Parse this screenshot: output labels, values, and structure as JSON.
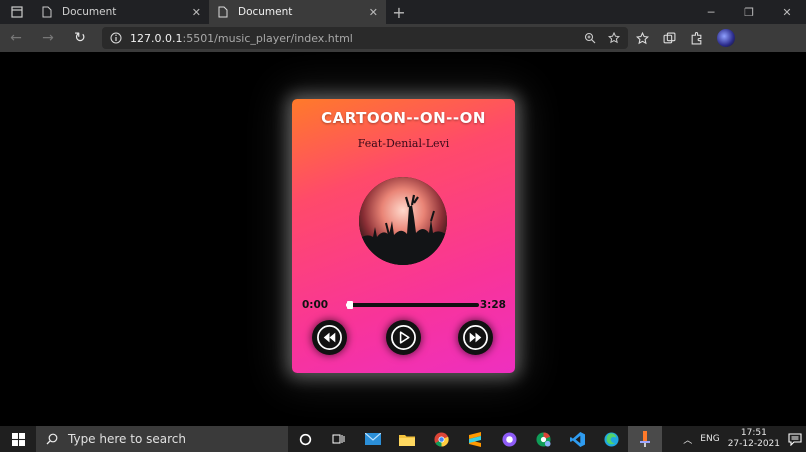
{
  "browser": {
    "tabs": [
      {
        "title": "Document",
        "active": false
      },
      {
        "title": "Document",
        "active": true
      }
    ],
    "url_host": "127.0.0.1",
    "url_rest": ":5501/music_player/index.html"
  },
  "player": {
    "title": "CARTOON--ON--ON",
    "artist": "Feat-Denial-Levi",
    "current_time": "0:00",
    "total_time": "3:28",
    "progress_fraction": 0.02,
    "colors": {
      "gradient_top": "#ff7a2a",
      "gradient_bottom": "#ee2fc0",
      "button_bg": "#111111"
    },
    "controls": [
      {
        "icon": "rewind-icon"
      },
      {
        "icon": "play-icon"
      },
      {
        "icon": "fast-forward-icon"
      }
    ]
  },
  "taskbar": {
    "search_placeholder": "Type here to search",
    "language": "ENG",
    "time": "17:51",
    "date": "27-12-2021"
  }
}
